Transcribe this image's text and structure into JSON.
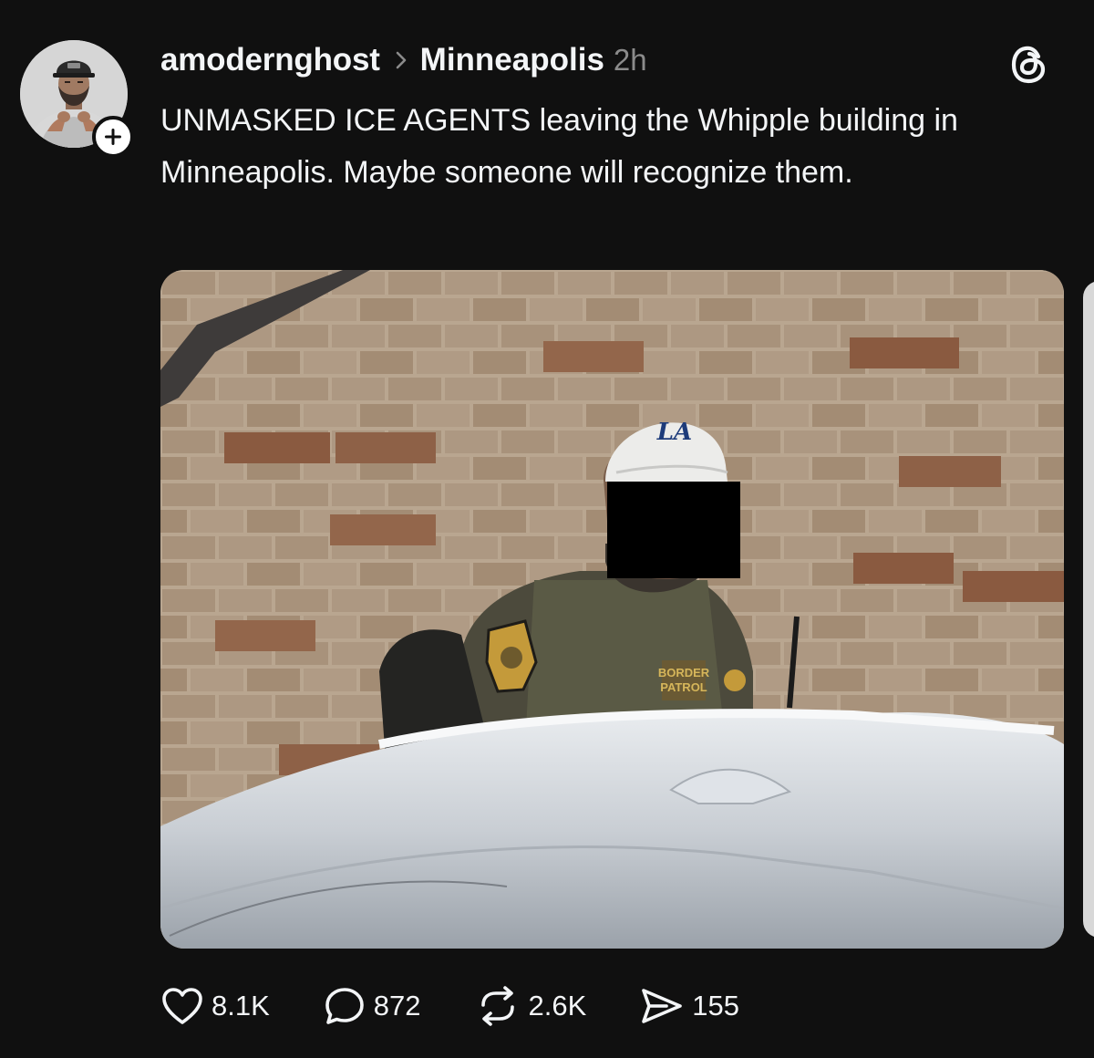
{
  "post": {
    "author": {
      "username": "amodernghost",
      "avatar_icon": "profile-photo",
      "follow_icon": "plus-icon"
    },
    "community": "Minneapolis",
    "timestamp": "2h",
    "app_icon": "threads-logo-icon",
    "caption": "UNMASKED ICE AGENTS leaving the Whipple building in Minneapolis. Maybe someone will recognize them.",
    "photo": {
      "cap_logo_text": "LA",
      "vest_patch_line1": "BORDER",
      "vest_patch_line2": "PATROL"
    },
    "stats": {
      "likes": "8.1K",
      "replies": "872",
      "reposts": "2.6K",
      "shares": "155"
    }
  },
  "colors": {
    "background": "#101010",
    "text_primary": "#f3f5f7",
    "text_secondary": "#8b8b8b"
  }
}
